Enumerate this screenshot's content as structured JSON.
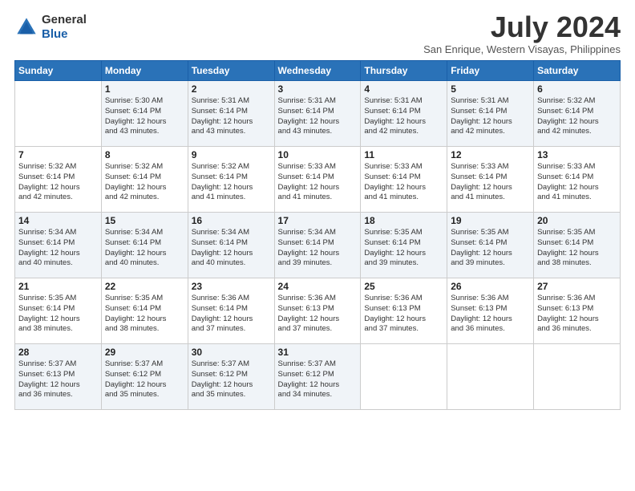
{
  "logo": {
    "line1": "General",
    "line2": "Blue"
  },
  "title": "July 2024",
  "location": "San Enrique, Western Visayas, Philippines",
  "weekdays": [
    "Sunday",
    "Monday",
    "Tuesday",
    "Wednesday",
    "Thursday",
    "Friday",
    "Saturday"
  ],
  "weeks": [
    [
      {
        "day": "",
        "sunrise": "",
        "sunset": "",
        "daylight": ""
      },
      {
        "day": "1",
        "sunrise": "Sunrise: 5:30 AM",
        "sunset": "Sunset: 6:14 PM",
        "daylight": "Daylight: 12 hours and 43 minutes."
      },
      {
        "day": "2",
        "sunrise": "Sunrise: 5:31 AM",
        "sunset": "Sunset: 6:14 PM",
        "daylight": "Daylight: 12 hours and 43 minutes."
      },
      {
        "day": "3",
        "sunrise": "Sunrise: 5:31 AM",
        "sunset": "Sunset: 6:14 PM",
        "daylight": "Daylight: 12 hours and 43 minutes."
      },
      {
        "day": "4",
        "sunrise": "Sunrise: 5:31 AM",
        "sunset": "Sunset: 6:14 PM",
        "daylight": "Daylight: 12 hours and 42 minutes."
      },
      {
        "day": "5",
        "sunrise": "Sunrise: 5:31 AM",
        "sunset": "Sunset: 6:14 PM",
        "daylight": "Daylight: 12 hours and 42 minutes."
      },
      {
        "day": "6",
        "sunrise": "Sunrise: 5:32 AM",
        "sunset": "Sunset: 6:14 PM",
        "daylight": "Daylight: 12 hours and 42 minutes."
      }
    ],
    [
      {
        "day": "7",
        "sunrise": "Sunrise: 5:32 AM",
        "sunset": "Sunset: 6:14 PM",
        "daylight": "Daylight: 12 hours and 42 minutes."
      },
      {
        "day": "8",
        "sunrise": "Sunrise: 5:32 AM",
        "sunset": "Sunset: 6:14 PM",
        "daylight": "Daylight: 12 hours and 42 minutes."
      },
      {
        "day": "9",
        "sunrise": "Sunrise: 5:32 AM",
        "sunset": "Sunset: 6:14 PM",
        "daylight": "Daylight: 12 hours and 41 minutes."
      },
      {
        "day": "10",
        "sunrise": "Sunrise: 5:33 AM",
        "sunset": "Sunset: 6:14 PM",
        "daylight": "Daylight: 12 hours and 41 minutes."
      },
      {
        "day": "11",
        "sunrise": "Sunrise: 5:33 AM",
        "sunset": "Sunset: 6:14 PM",
        "daylight": "Daylight: 12 hours and 41 minutes."
      },
      {
        "day": "12",
        "sunrise": "Sunrise: 5:33 AM",
        "sunset": "Sunset: 6:14 PM",
        "daylight": "Daylight: 12 hours and 41 minutes."
      },
      {
        "day": "13",
        "sunrise": "Sunrise: 5:33 AM",
        "sunset": "Sunset: 6:14 PM",
        "daylight": "Daylight: 12 hours and 41 minutes."
      }
    ],
    [
      {
        "day": "14",
        "sunrise": "Sunrise: 5:34 AM",
        "sunset": "Sunset: 6:14 PM",
        "daylight": "Daylight: 12 hours and 40 minutes."
      },
      {
        "day": "15",
        "sunrise": "Sunrise: 5:34 AM",
        "sunset": "Sunset: 6:14 PM",
        "daylight": "Daylight: 12 hours and 40 minutes."
      },
      {
        "day": "16",
        "sunrise": "Sunrise: 5:34 AM",
        "sunset": "Sunset: 6:14 PM",
        "daylight": "Daylight: 12 hours and 40 minutes."
      },
      {
        "day": "17",
        "sunrise": "Sunrise: 5:34 AM",
        "sunset": "Sunset: 6:14 PM",
        "daylight": "Daylight: 12 hours and 39 minutes."
      },
      {
        "day": "18",
        "sunrise": "Sunrise: 5:35 AM",
        "sunset": "Sunset: 6:14 PM",
        "daylight": "Daylight: 12 hours and 39 minutes."
      },
      {
        "day": "19",
        "sunrise": "Sunrise: 5:35 AM",
        "sunset": "Sunset: 6:14 PM",
        "daylight": "Daylight: 12 hours and 39 minutes."
      },
      {
        "day": "20",
        "sunrise": "Sunrise: 5:35 AM",
        "sunset": "Sunset: 6:14 PM",
        "daylight": "Daylight: 12 hours and 38 minutes."
      }
    ],
    [
      {
        "day": "21",
        "sunrise": "Sunrise: 5:35 AM",
        "sunset": "Sunset: 6:14 PM",
        "daylight": "Daylight: 12 hours and 38 minutes."
      },
      {
        "day": "22",
        "sunrise": "Sunrise: 5:35 AM",
        "sunset": "Sunset: 6:14 PM",
        "daylight": "Daylight: 12 hours and 38 minutes."
      },
      {
        "day": "23",
        "sunrise": "Sunrise: 5:36 AM",
        "sunset": "Sunset: 6:14 PM",
        "daylight": "Daylight: 12 hours and 37 minutes."
      },
      {
        "day": "24",
        "sunrise": "Sunrise: 5:36 AM",
        "sunset": "Sunset: 6:13 PM",
        "daylight": "Daylight: 12 hours and 37 minutes."
      },
      {
        "day": "25",
        "sunrise": "Sunrise: 5:36 AM",
        "sunset": "Sunset: 6:13 PM",
        "daylight": "Daylight: 12 hours and 37 minutes."
      },
      {
        "day": "26",
        "sunrise": "Sunrise: 5:36 AM",
        "sunset": "Sunset: 6:13 PM",
        "daylight": "Daylight: 12 hours and 36 minutes."
      },
      {
        "day": "27",
        "sunrise": "Sunrise: 5:36 AM",
        "sunset": "Sunset: 6:13 PM",
        "daylight": "Daylight: 12 hours and 36 minutes."
      }
    ],
    [
      {
        "day": "28",
        "sunrise": "Sunrise: 5:37 AM",
        "sunset": "Sunset: 6:13 PM",
        "daylight": "Daylight: 12 hours and 36 minutes."
      },
      {
        "day": "29",
        "sunrise": "Sunrise: 5:37 AM",
        "sunset": "Sunset: 6:12 PM",
        "daylight": "Daylight: 12 hours and 35 minutes."
      },
      {
        "day": "30",
        "sunrise": "Sunrise: 5:37 AM",
        "sunset": "Sunset: 6:12 PM",
        "daylight": "Daylight: 12 hours and 35 minutes."
      },
      {
        "day": "31",
        "sunrise": "Sunrise: 5:37 AM",
        "sunset": "Sunset: 6:12 PM",
        "daylight": "Daylight: 12 hours and 34 minutes."
      },
      {
        "day": "",
        "sunrise": "",
        "sunset": "",
        "daylight": ""
      },
      {
        "day": "",
        "sunrise": "",
        "sunset": "",
        "daylight": ""
      },
      {
        "day": "",
        "sunrise": "",
        "sunset": "",
        "daylight": ""
      }
    ]
  ]
}
